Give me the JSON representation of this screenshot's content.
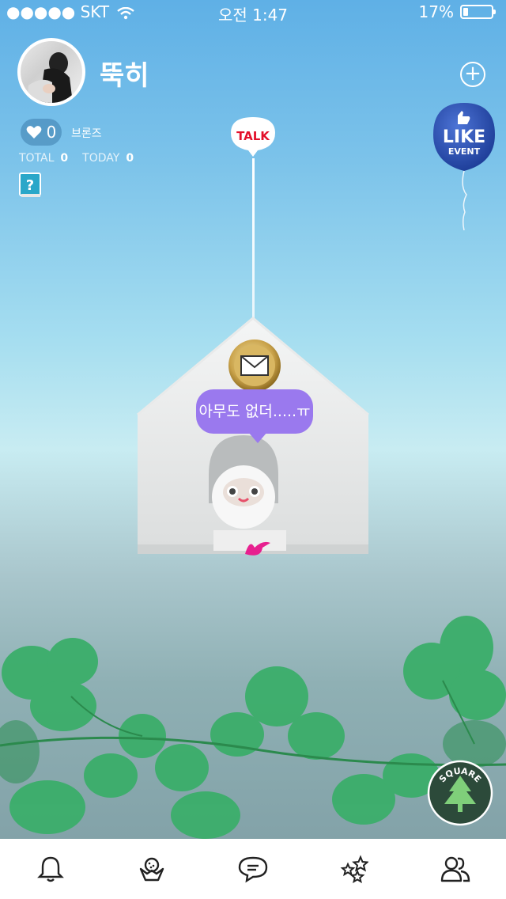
{
  "status_bar": {
    "carrier": "●●●●● SKT",
    "time": "오전 1:47",
    "battery_percent": "17%",
    "battery_level": 0.17
  },
  "profile": {
    "name": "뚝히",
    "likes": "0",
    "grade": "브론즈",
    "total_label": "TOTAL",
    "total_value": "0",
    "today_label": "TODAY",
    "today_value": "0"
  },
  "balloons": {
    "talk": "TALK",
    "like_title": "LIKE",
    "like_sub": "EVENT"
  },
  "house": {
    "speech": "아무도 없더.....ㅠ"
  },
  "square_label": "SQUARE",
  "tabs": [
    {
      "icon": "bell-icon"
    },
    {
      "icon": "cookie-bag-icon"
    },
    {
      "icon": "chat-bubble-icon"
    },
    {
      "icon": "stars-icon"
    },
    {
      "icon": "friends-icon"
    }
  ],
  "colors": {
    "accent_pink": "#ff3fa0",
    "speech_purple": "#9a79ee",
    "leaf_green": "#3fb36a"
  }
}
